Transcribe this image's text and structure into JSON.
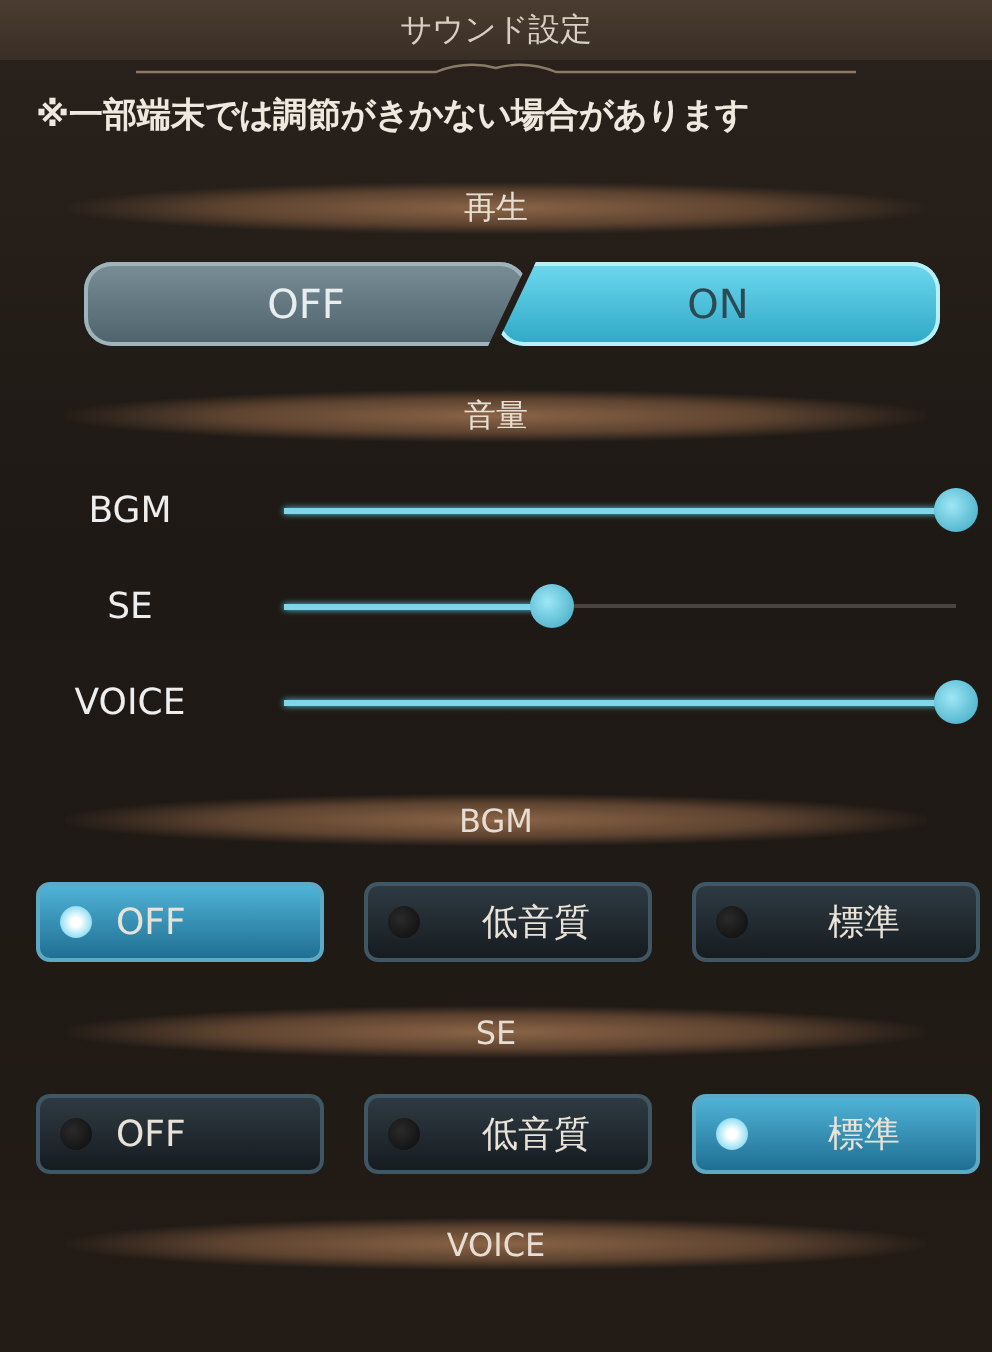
{
  "window": {
    "title": "サウンド設定"
  },
  "note": "※一部端末では調節がきかない場合があります",
  "sections": [
    {
      "kind": "toggle",
      "header": "再生",
      "options": [
        {
          "label": "OFF",
          "selected": false
        },
        {
          "label": "ON",
          "selected": true
        }
      ]
    },
    {
      "kind": "sliders",
      "header": "音量",
      "sliders": [
        {
          "label": "BGM",
          "level": 1.0
        },
        {
          "label": "SE",
          "level": 0.4
        },
        {
          "label": "VOICE",
          "level": 1.0
        }
      ]
    },
    {
      "kind": "radio",
      "header": "BGM",
      "options": [
        {
          "label": "OFF",
          "selected": true
        },
        {
          "label": "低音質",
          "selected": false
        },
        {
          "label": "標準",
          "selected": false
        }
      ]
    },
    {
      "kind": "radio",
      "header": "SE",
      "options": [
        {
          "label": "OFF",
          "selected": false
        },
        {
          "label": "低音質",
          "selected": false
        },
        {
          "label": "標準",
          "selected": true
        }
      ]
    },
    {
      "kind": "header",
      "header": "VOICE"
    }
  ]
}
